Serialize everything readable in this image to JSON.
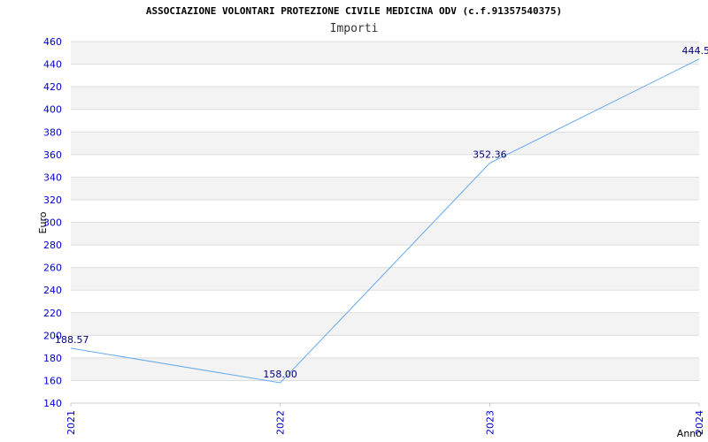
{
  "chart_data": {
    "type": "line",
    "title": "ASSOCIAZIONE VOLONTARI PROTEZIONE CIVILE MEDICINA ODV (c.f.91357540375)",
    "subtitle": "Importi",
    "xlabel": "Anno",
    "ylabel": "Euro",
    "categories": [
      "2021",
      "2022",
      "2023",
      "2024"
    ],
    "series": [
      {
        "values": [
          188.57,
          158.0,
          352.36,
          444.5
        ],
        "labels": [
          "188.57",
          "158.00",
          "352.36",
          "444.5"
        ],
        "color": "#66aaee"
      }
    ],
    "ylim": [
      140,
      460
    ],
    "yticks": [
      140,
      160,
      180,
      200,
      220,
      240,
      260,
      280,
      300,
      320,
      340,
      360,
      380,
      400,
      420,
      440,
      460
    ],
    "ytick_labels": [
      "140",
      "160",
      "180",
      "200",
      "220",
      "240",
      "260",
      "280",
      "300",
      "320",
      "340",
      "360",
      "380",
      "400",
      "420",
      "440",
      "460"
    ],
    "grid": true,
    "band_colors": [
      "#ffffff",
      "#f3f3f3"
    ]
  }
}
